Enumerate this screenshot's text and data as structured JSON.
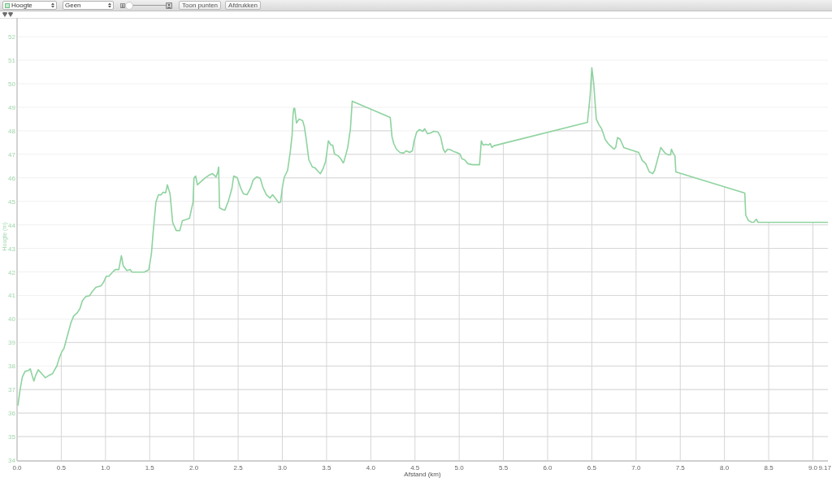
{
  "toolbar": {
    "series_select": {
      "value": "Hoogte"
    },
    "overlay_select": {
      "value": "Geen"
    },
    "zoom_slider": {
      "level": 0
    },
    "buttons": [
      "Toon punten",
      "Afdrukken"
    ]
  },
  "chart": {
    "chart_data": {
      "type": "line",
      "xlabel": "Afstand (km)",
      "ylabel": "Hoogte (m)",
      "grid": true,
      "x": [
        0.01,
        0.03,
        0.06,
        0.09,
        0.13,
        0.15,
        0.17,
        0.19,
        0.21,
        0.24,
        0.28,
        0.32,
        0.36,
        0.4,
        0.45,
        0.48,
        0.51,
        0.53,
        0.56,
        0.61,
        0.64,
        0.68,
        0.71,
        0.74,
        0.78,
        0.82,
        0.85,
        0.89,
        0.95,
        0.98,
        1.01,
        1.04,
        1.08,
        1.11,
        1.15,
        1.18,
        1.2,
        1.24,
        1.28,
        1.3,
        1.34,
        1.44,
        1.49,
        1.52,
        1.54,
        1.57,
        1.6,
        1.63,
        1.65,
        1.68,
        1.7,
        1.73,
        1.76,
        1.8,
        1.84,
        1.87,
        1.92,
        1.95,
        1.99,
        2.0,
        2.02,
        2.04,
        2.08,
        2.12,
        2.17,
        2.21,
        2.25,
        2.27,
        2.28,
        2.29,
        2.32,
        2.35,
        2.39,
        2.43,
        2.45,
        2.49,
        2.53,
        2.56,
        2.6,
        2.64,
        2.67,
        2.71,
        2.75,
        2.78,
        2.82,
        2.86,
        2.89,
        2.92,
        2.96,
        2.98,
        3.0,
        3.02,
        3.06,
        3.09,
        3.11,
        3.12,
        3.13,
        3.14,
        3.16,
        3.19,
        3.23,
        3.25,
        3.27,
        3.3,
        3.34,
        3.37,
        3.41,
        3.43,
        3.46,
        3.49,
        3.52,
        3.55,
        3.57,
        3.59,
        3.63,
        3.66,
        3.69,
        3.7,
        3.74,
        3.77,
        3.79,
        4.22,
        4.24,
        4.26,
        4.29,
        4.33,
        4.37,
        4.4,
        4.44,
        4.47,
        4.49,
        4.52,
        4.55,
        4.59,
        4.61,
        4.64,
        4.68,
        4.71,
        4.76,
        4.79,
        4.82,
        4.84,
        4.87,
        4.9,
        4.94,
        4.97,
        5.01,
        5.03,
        5.06,
        5.1,
        5.15,
        5.23,
        5.25,
        5.27,
        5.3,
        5.33,
        5.35,
        5.37,
        5.39,
        6.45,
        6.48,
        6.5,
        6.52,
        6.55,
        6.58,
        6.61,
        6.63,
        6.65,
        6.69,
        6.73,
        6.75,
        6.77,
        6.79,
        6.82,
        6.85,
        6.86,
        7.03,
        7.07,
        7.11,
        7.15,
        7.19,
        7.21,
        7.25,
        7.28,
        7.33,
        7.36,
        7.39,
        7.4,
        7.42,
        7.44,
        7.45,
        8.23,
        8.24,
        8.27,
        8.31,
        8.33,
        8.36,
        8.38,
        9.17
      ],
      "values": [
        36.32,
        36.91,
        37.53,
        37.77,
        37.81,
        37.88,
        37.6,
        37.36,
        37.6,
        37.84,
        37.67,
        37.5,
        37.6,
        37.67,
        38.01,
        38.36,
        38.64,
        38.74,
        39.16,
        39.85,
        40.13,
        40.26,
        40.44,
        40.78,
        40.96,
        40.99,
        41.16,
        41.34,
        41.41,
        41.58,
        41.82,
        41.82,
        41.99,
        42.1,
        42.1,
        42.69,
        42.27,
        42.06,
        42.1,
        41.99,
        41.99,
        41.99,
        42.1,
        42.79,
        43.73,
        44.97,
        45.28,
        45.28,
        45.39,
        45.36,
        45.7,
        45.32,
        44.11,
        43.76,
        43.76,
        44.18,
        44.24,
        44.28,
        44.97,
        45.98,
        46.08,
        45.7,
        45.84,
        45.98,
        46.11,
        46.18,
        46.04,
        46.25,
        46.46,
        44.73,
        44.66,
        44.63,
        45.01,
        45.56,
        46.08,
        46.01,
        45.56,
        45.32,
        45.28,
        45.56,
        45.91,
        46.04,
        45.98,
        45.59,
        45.28,
        45.14,
        45.28,
        45.14,
        44.94,
        44.97,
        45.59,
        46.01,
        46.32,
        47.12,
        47.81,
        48.67,
        48.95,
        48.95,
        48.33,
        48.5,
        48.43,
        48.16,
        47.64,
        46.77,
        46.46,
        46.42,
        46.25,
        46.18,
        46.39,
        46.7,
        47.57,
        47.39,
        47.39,
        47.01,
        46.94,
        46.81,
        46.63,
        46.74,
        47.29,
        48.09,
        49.26,
        48.57,
        47.74,
        47.46,
        47.22,
        47.08,
        47.05,
        47.15,
        47.08,
        47.15,
        47.57,
        47.95,
        48.05,
        47.98,
        48.09,
        47.88,
        47.91,
        47.98,
        47.95,
        47.74,
        47.22,
        47.08,
        47.22,
        47.19,
        47.12,
        47.08,
        47.01,
        46.81,
        46.77,
        46.6,
        46.56,
        46.56,
        47.57,
        47.39,
        47.43,
        47.39,
        47.46,
        47.29,
        47.36,
        48.36,
        49.44,
        50.68,
        50.06,
        48.5,
        48.26,
        48.09,
        47.88,
        47.64,
        47.43,
        47.29,
        47.22,
        47.29,
        47.71,
        47.64,
        47.39,
        47.29,
        47.08,
        46.74,
        46.6,
        46.25,
        46.18,
        46.32,
        46.87,
        47.29,
        47.05,
        46.98,
        46.98,
        47.22,
        47.05,
        46.94,
        46.25,
        45.35,
        44.42,
        44.18,
        44.11,
        44.11,
        44.24,
        44.11,
        44.11
      ],
      "xlim": [
        0,
        9.17
      ],
      "ylim": [
        34,
        52.8
      ],
      "xticks": [
        {
          "value": 0,
          "label": "0.0"
        },
        {
          "value": 0.5,
          "label": "0.5"
        },
        {
          "value": 1,
          "label": "1.0"
        },
        {
          "value": 1.5,
          "label": "1.5"
        },
        {
          "value": 2,
          "label": "2.0"
        },
        {
          "value": 2.5,
          "label": "2.5"
        },
        {
          "value": 3,
          "label": "3.0"
        },
        {
          "value": 3.5,
          "label": "3.5"
        },
        {
          "value": 4,
          "label": "4.0"
        },
        {
          "value": 4.5,
          "label": "4.5"
        },
        {
          "value": 5,
          "label": "5.0"
        },
        {
          "value": 5.5,
          "label": "5.5"
        },
        {
          "value": 6,
          "label": "6.0"
        },
        {
          "value": 6.5,
          "label": "6.5"
        },
        {
          "value": 7,
          "label": "7.0"
        },
        {
          "value": 7.5,
          "label": "7.5"
        },
        {
          "value": 8,
          "label": "8.0"
        },
        {
          "value": 8.5,
          "label": "8.5"
        },
        {
          "value": 9,
          "label": "9.0"
        },
        {
          "value": 9.17,
          "label": "9.17"
        }
      ],
      "yticks": [
        34,
        35,
        36,
        37,
        38,
        39,
        40,
        41,
        42,
        43,
        44,
        45,
        46,
        47,
        48,
        49,
        50,
        51,
        52
      ]
    }
  }
}
